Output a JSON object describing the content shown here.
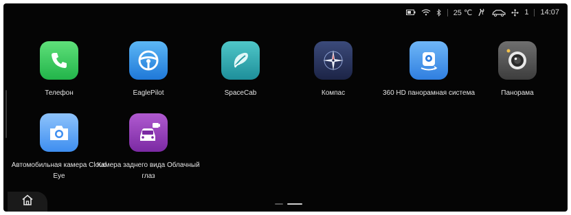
{
  "status_bar": {
    "temperature": "25 ℃",
    "fan_level": "1",
    "time": "14:07",
    "icons": [
      "battery-icon",
      "wifi-icon",
      "bluetooth-icon",
      "seat-heat-icon",
      "car-icon",
      "fan-icon"
    ]
  },
  "apps": [
    {
      "label": "Телефон",
      "icon": "phone-icon"
    },
    {
      "label": "EaglePilot",
      "icon": "steering-wheel-icon"
    },
    {
      "label": "SpaceCab",
      "icon": "spacecab-icon"
    },
    {
      "label": "Компас",
      "icon": "compass-icon"
    },
    {
      "label": "360 HD панорамная система",
      "icon": "camera-360-icon"
    },
    {
      "label": "Панорама",
      "icon": "lens-icon"
    },
    {
      "label": "Автомобильная камера Cloud Eye",
      "icon": "camera-icon"
    },
    {
      "label": "Камера заднего вида Облачный глаз",
      "icon": "rear-camera-icon"
    }
  ],
  "dock": {
    "home_icon": "home-icon"
  },
  "pager": {
    "pages": 2,
    "active_page": 2
  }
}
